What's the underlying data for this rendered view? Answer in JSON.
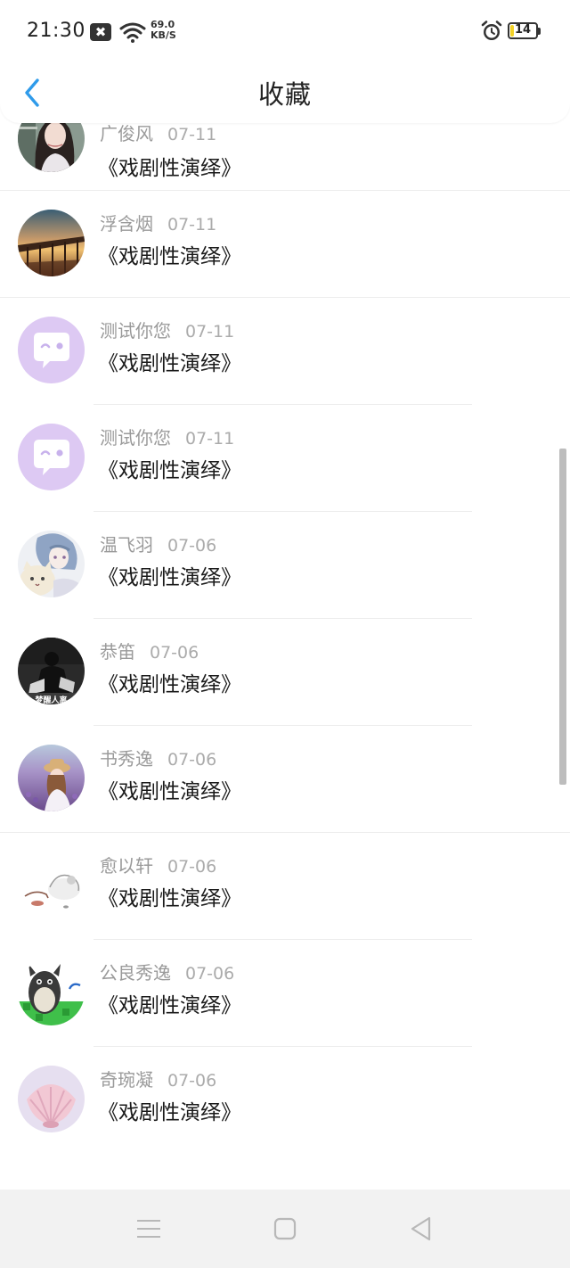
{
  "status_bar": {
    "time": "21:30",
    "notification_glyph": "✖",
    "net_speed_value": "69.0",
    "net_speed_unit": "KB/S",
    "battery_level": "14",
    "icons": [
      "close-box-icon",
      "wifi-icon",
      "alarm-clock-icon",
      "battery-icon"
    ]
  },
  "nav": {
    "title": "收藏",
    "back_icon": "chevron-left-icon",
    "accent_color": "#2f9bea"
  },
  "favorites": [
    {
      "name": "广俊风",
      "date": "07-11",
      "title": "《戏剧性演绎》",
      "avatar": "girl-portrait"
    },
    {
      "name": "浮含烟",
      "date": "07-11",
      "title": "《戏剧性演绎》",
      "avatar": "pier-sunset"
    },
    {
      "name": "测试你您",
      "date": "07-11",
      "title": "《戏剧性演绎》",
      "avatar": "default-chat-bubble"
    },
    {
      "name": "测试你您",
      "date": "07-11",
      "title": "《戏剧性演绎》",
      "avatar": "default-chat-bubble"
    },
    {
      "name": "温飞羽",
      "date": "07-06",
      "title": "《戏剧性演绎》",
      "avatar": "anime-boy-cat"
    },
    {
      "name": "恭笛",
      "date": "07-06",
      "title": "《戏剧性演绎》",
      "avatar": "dark-figure",
      "avatar_text": "梦醒人离"
    },
    {
      "name": "书秀逸",
      "date": "07-06",
      "title": "《戏剧性演绎》",
      "avatar": "girl-lavender-field"
    },
    {
      "name": "愈以轩",
      "date": "07-06",
      "title": "《戏剧性演绎》",
      "avatar": "white-bird"
    },
    {
      "name": "公良秀逸",
      "date": "07-06",
      "title": "《戏剧性演绎》",
      "avatar": "totoro"
    },
    {
      "name": "奇琬凝",
      "date": "07-06",
      "title": "《戏剧性演绎》",
      "avatar": "pink-seashell"
    }
  ],
  "system_nav": {
    "icons": [
      "menu-lines-icon",
      "home-square-icon",
      "back-triangle-icon"
    ]
  }
}
